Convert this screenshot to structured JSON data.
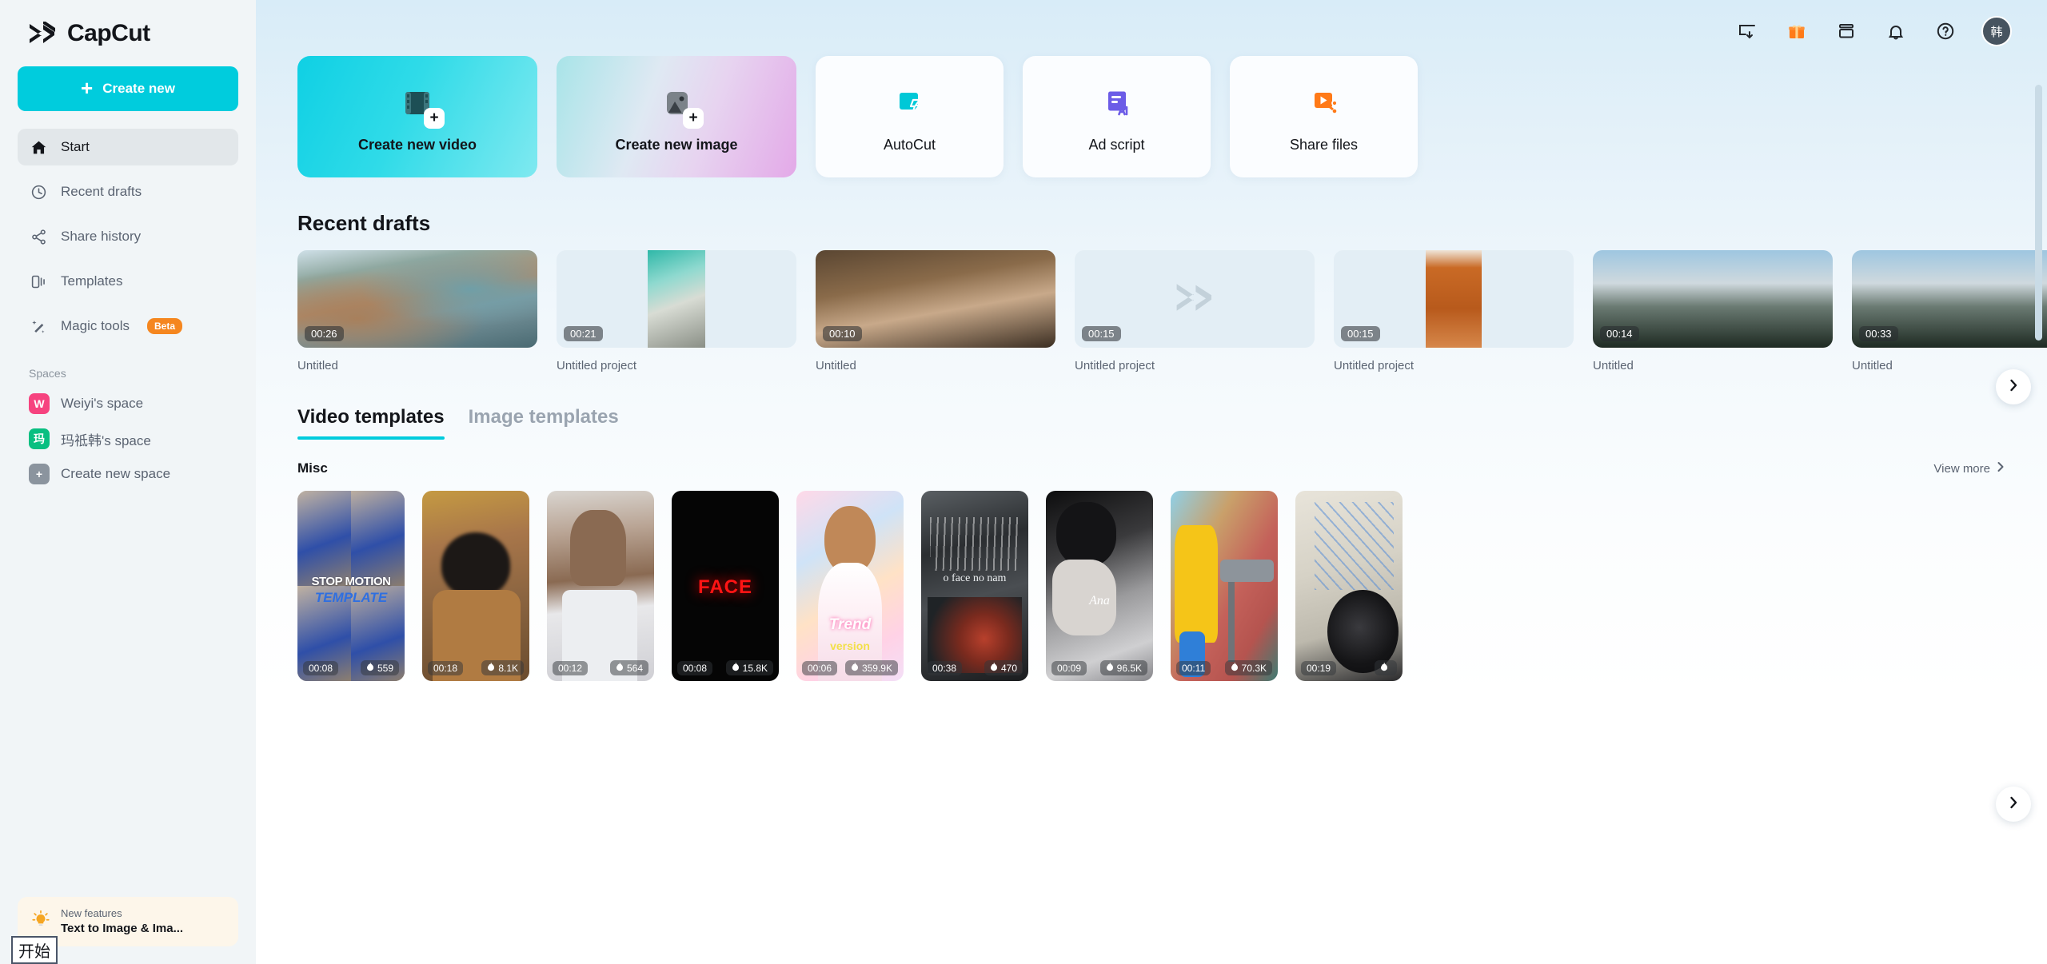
{
  "app": {
    "brand": "CapCut"
  },
  "sidebar": {
    "create_new_label": "Create new",
    "items": [
      {
        "label": "Start",
        "icon": "home-icon"
      },
      {
        "label": "Recent drafts",
        "icon": "clock-icon"
      },
      {
        "label": "Share history",
        "icon": "share-icon"
      },
      {
        "label": "Templates",
        "icon": "templates-icon"
      },
      {
        "label": "Magic tools",
        "icon": "magic-wand-icon",
        "badge": "Beta"
      }
    ],
    "spaces_label": "Spaces",
    "spaces": [
      {
        "label": "Weiyi's space",
        "initial": "W",
        "color": "#f6437f"
      },
      {
        "label": "玛祗韩's space",
        "initial": "玛",
        "color": "#09bf81"
      },
      {
        "label": "Create new space",
        "initial": "+",
        "color": "#8b949e"
      }
    ],
    "promo": {
      "eyebrow": "New features",
      "title": "Text to Image & Ima...",
      "icon": "lightbulb-icon"
    },
    "ime_hint": "开始"
  },
  "topbar": {
    "icons": [
      {
        "name": "download-to-desktop-icon"
      },
      {
        "name": "gift-icon"
      },
      {
        "name": "inbox-icon"
      },
      {
        "name": "bell-icon"
      },
      {
        "name": "help-circle-icon"
      }
    ],
    "avatar_initial": "韩"
  },
  "actions": [
    {
      "label": "Create new video",
      "icon": "film-plus-icon",
      "style": "video"
    },
    {
      "label": "Create new image",
      "icon": "image-plus-icon",
      "style": "image"
    },
    {
      "label": "AutoCut",
      "icon": "autocut-icon",
      "style": "plain"
    },
    {
      "label": "Ad script",
      "icon": "ad-script-ai-icon",
      "style": "plain"
    },
    {
      "label": "Share files",
      "icon": "share-files-icon",
      "style": "plain"
    }
  ],
  "drafts": {
    "title": "Recent drafts",
    "items": [
      {
        "name": "Untitled",
        "duration": "00:26",
        "thumb": "canyon-road"
      },
      {
        "name": "Untitled project",
        "duration": "00:21",
        "thumb": "ocean-cliff"
      },
      {
        "name": "Untitled",
        "duration": "00:10",
        "thumb": "party-people"
      },
      {
        "name": "Untitled project",
        "duration": "00:15",
        "thumb": "empty-capcut"
      },
      {
        "name": "Untitled project",
        "duration": "00:15",
        "thumb": "fashionable-handbag"
      },
      {
        "name": "Untitled",
        "duration": "00:14",
        "thumb": "snow-mountain"
      },
      {
        "name": "Untitled",
        "duration": "00:33",
        "thumb": "snow-mountain-2"
      }
    ]
  },
  "templates": {
    "tabs": [
      {
        "label": "Video templates",
        "active": true
      },
      {
        "label": "Image templates",
        "active": false
      }
    ],
    "category": "Misc",
    "view_more": "View more",
    "items": [
      {
        "duration": "00:08",
        "plays": "559",
        "thumb": "stop-motion-template",
        "overlay_top": "STOP MOTION",
        "overlay_bottom": "TEMPLATE"
      },
      {
        "duration": "00:18",
        "plays": "8.1K",
        "thumb": "brown-hoodie-selfie"
      },
      {
        "duration": "00:12",
        "plays": "564",
        "thumb": "white-pants-dance"
      },
      {
        "duration": "00:08",
        "plays": "15.8K",
        "thumb": "face-neon",
        "overlay_top": "FACE"
      },
      {
        "duration": "00:06",
        "plays": "359.9K",
        "thumb": "pregnant-trend",
        "overlay_top": "Trend",
        "overlay_bottom": "version"
      },
      {
        "duration": "00:38",
        "plays": "470",
        "thumb": "no-face-no-name",
        "overlay_top": "o face no nam"
      },
      {
        "duration": "00:09",
        "plays": "96.5K",
        "thumb": "ana-bw-portrait",
        "overlay_top": "Ana"
      },
      {
        "duration": "00:11",
        "plays": "70.3K",
        "thumb": "bart-telescope"
      },
      {
        "duration": "00:19",
        "plays": "",
        "thumb": "wires-desk"
      }
    ]
  }
}
